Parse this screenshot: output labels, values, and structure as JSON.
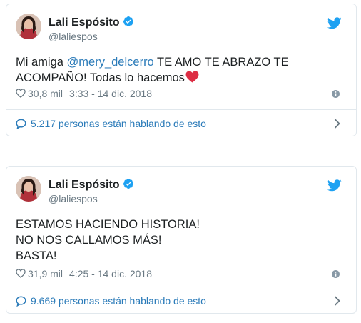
{
  "tweets": [
    {
      "author_name": "Lali Espósito",
      "author_handle": "@laliespos",
      "text_before_mention": "Mi amiga ",
      "mention": "@mery_delcerro",
      "text_after_mention": " TE AMO TE ABRAZO TE ACOMPAÑO! Todas lo hacemos",
      "likes": "30,8 mil",
      "timestamp": "3:33 - 14 dic. 2018",
      "conversation": "5.217 personas están hablando de esto"
    },
    {
      "author_name": "Lali Espósito",
      "author_handle": "@laliespos",
      "lines": [
        "ESTAMOS HACIENDO HISTORIA!",
        "NO NOS CALLAMOS MÁS!",
        "BASTA!"
      ],
      "likes": "31,9 mil",
      "timestamp": "4:25 - 14 dic. 2018",
      "conversation": "9.669 personas están hablando de esto"
    }
  ],
  "colors": {
    "link": "#2b7bb9",
    "muted": "#697882",
    "border": "#e1e8ed",
    "twitter_blue": "#1da1f2",
    "heart_red": "#dd2e44"
  },
  "icons": [
    "twitter-bird-icon",
    "verified-badge-icon",
    "heart-outline-icon",
    "info-icon",
    "reply-bubble-icon",
    "chevron-right-icon",
    "red-heart-emoji"
  ]
}
